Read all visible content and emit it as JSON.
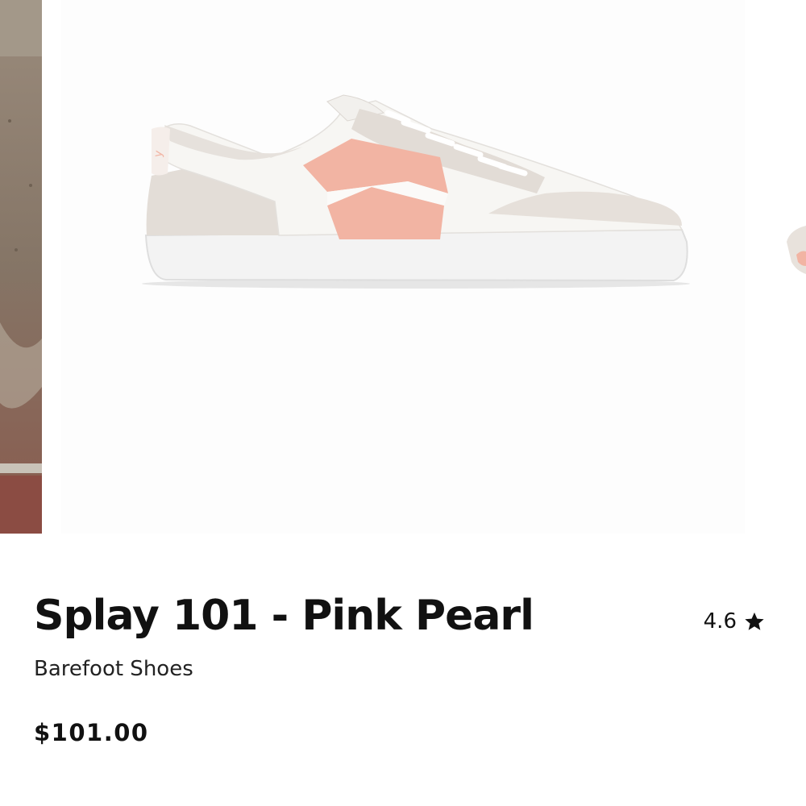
{
  "product": {
    "title": "Splay 101 - Pink Pearl",
    "subtitle": "Barefoot Shoes",
    "price": "$101.00",
    "rating": "4.6",
    "rating_icon": "star-icon"
  },
  "gallery": {
    "images": [
      {
        "description_icon": "street-photo-image"
      },
      {
        "description_icon": "sneaker-image"
      },
      {
        "description_icon": "sneaker-image-partial"
      }
    ]
  },
  "colors": {
    "text": "#111111",
    "accent_pink": "#f2b2a0",
    "suede_gray": "#e4dfda",
    "sole_white": "#f4f4f4"
  }
}
